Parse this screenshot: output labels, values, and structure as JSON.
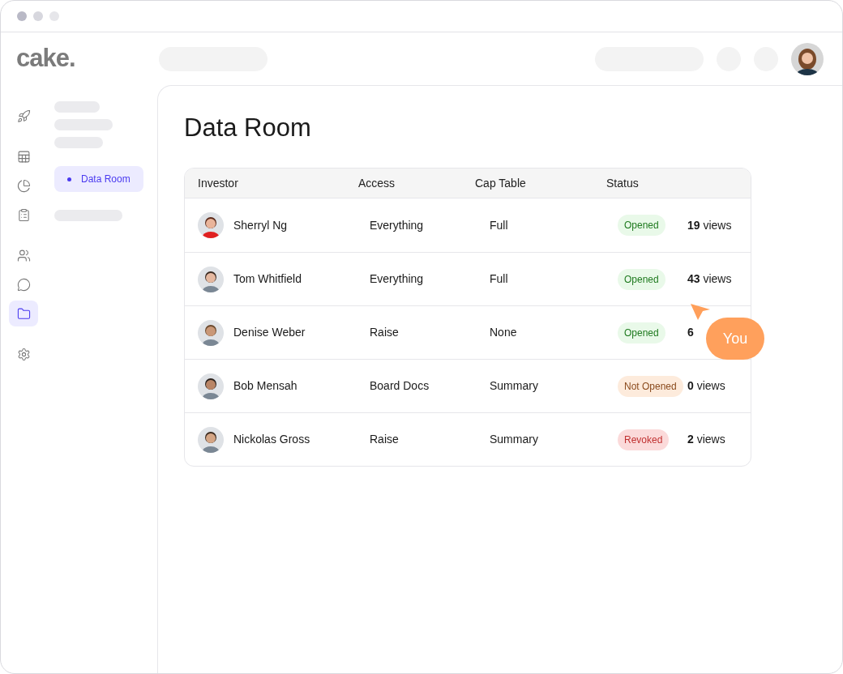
{
  "logo": "cake.",
  "rail": [
    {
      "selected": false
    },
    {
      "selected": false
    },
    {
      "selected": false
    },
    {
      "selected": false
    },
    {
      "selected": false
    },
    {
      "selected": false
    },
    {
      "selected": true
    },
    {
      "selected": false
    }
  ],
  "subnav": [
    {
      "kind": "skeleton"
    },
    {
      "kind": "skeleton"
    },
    {
      "kind": "skeleton"
    },
    {
      "kind": "item",
      "label": "Data Room",
      "selected": true
    },
    {
      "kind": "skeleton"
    }
  ],
  "page_title": "Data Room",
  "table": {
    "columns": [
      "Investor",
      "Access",
      "Cap Table",
      "Status"
    ],
    "rows": [
      {
        "investor": "Sherryl Ng",
        "access": "Everything",
        "cap_table": "Full",
        "status": {
          "label": "Opened",
          "kind": "opened"
        },
        "views": "**19** views"
      },
      {
        "investor": "Tom Whitfield",
        "access": "Everything",
        "cap_table": "Full",
        "status": {
          "label": "Opened",
          "kind": "opened"
        },
        "views": "**43** views"
      },
      {
        "investor": "Denise Weber",
        "access": "Raise",
        "cap_table": "None",
        "status": {
          "label": "Opened",
          "kind": "opened"
        },
        "views": "**6**"
      },
      {
        "investor": "Bob Mensah",
        "access": "Board Docs",
        "cap_table": "Summary",
        "status": {
          "label": "Not Opened",
          "kind": "not_opened"
        },
        "views": "**0** views"
      },
      {
        "investor": "Nickolas Gross",
        "access": "Raise",
        "cap_table": "Summary",
        "status": {
          "label": "Revoked",
          "kind": "revoked"
        },
        "views": "**2** views"
      }
    ]
  },
  "cursor": {
    "label": "You"
  }
}
